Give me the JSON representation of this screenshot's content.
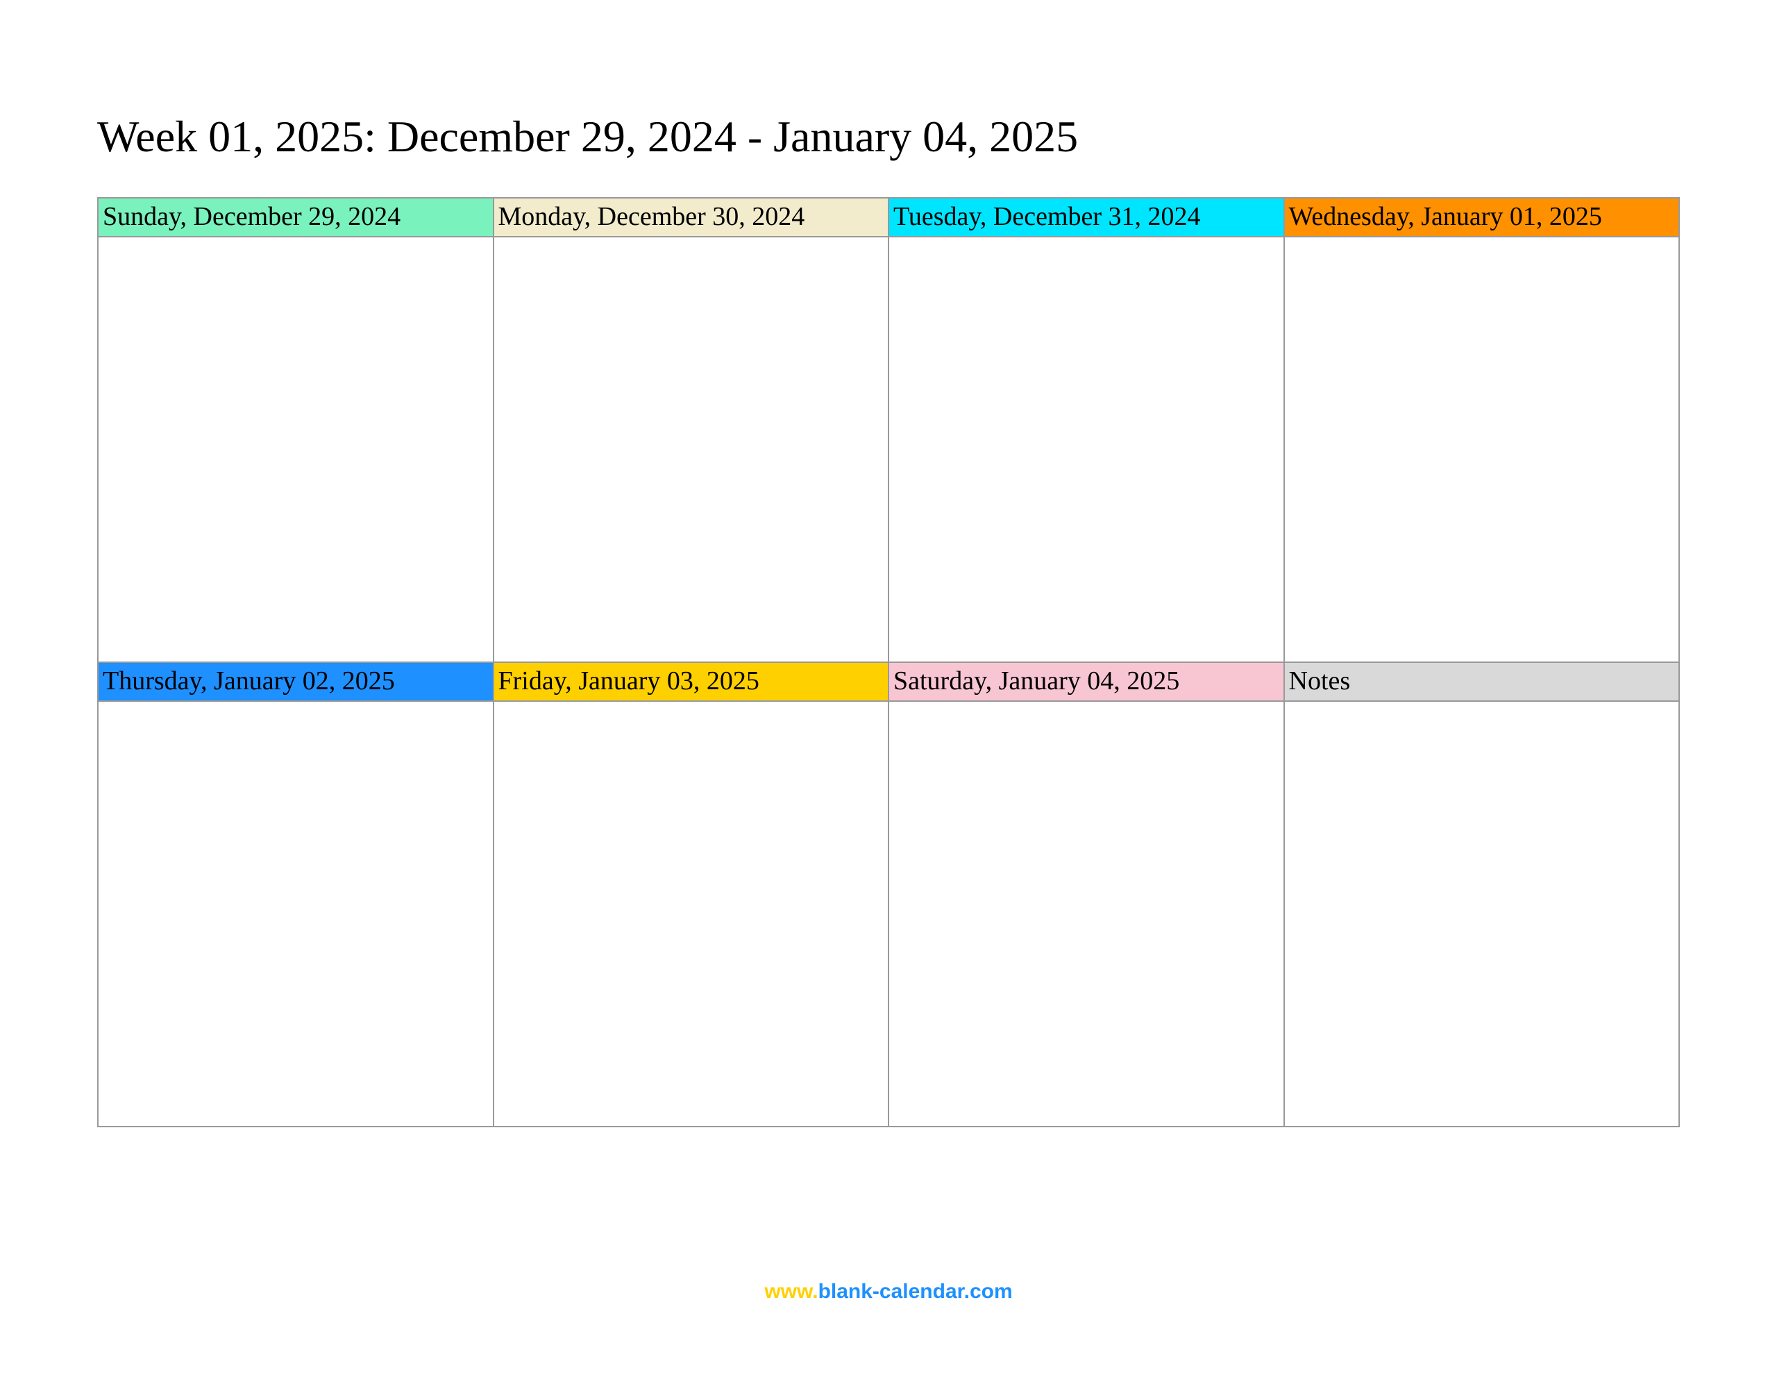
{
  "title": "Week 01, 2025: December 29, 2024 - January 04, 2025",
  "cells": [
    {
      "label": "Sunday, December 29, 2024",
      "colorClass": "c-mint"
    },
    {
      "label": "Monday, December 30, 2024",
      "colorClass": "c-cream"
    },
    {
      "label": "Tuesday, December 31, 2024",
      "colorClass": "c-cyan"
    },
    {
      "label": "Wednesday, January 01, 2025",
      "colorClass": "c-orange"
    },
    {
      "label": "Thursday, January 02, 2025",
      "colorClass": "c-blue"
    },
    {
      "label": "Friday, January 03, 2025",
      "colorClass": "c-yellow"
    },
    {
      "label": "Saturday, January 04, 2025",
      "colorClass": "c-pink"
    },
    {
      "label": "Notes",
      "colorClass": "c-grey"
    }
  ],
  "footer": {
    "part1": "www.",
    "part2": "blank-calendar.com"
  }
}
